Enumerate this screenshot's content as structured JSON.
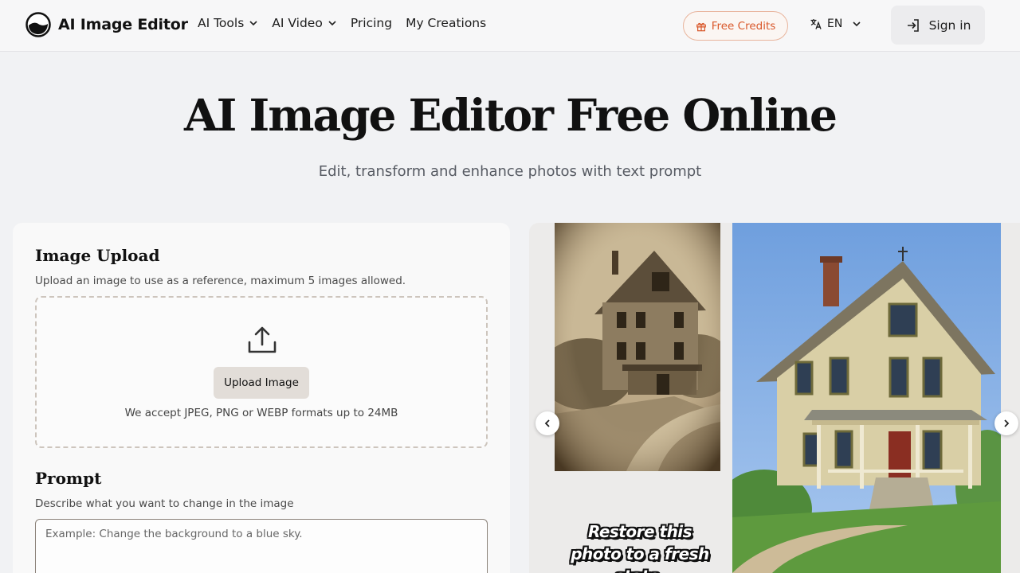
{
  "brand": {
    "name": "AI Image Editor"
  },
  "nav": [
    {
      "label": "AI Tools",
      "dropdown": true
    },
    {
      "label": "AI Video",
      "dropdown": true
    },
    {
      "label": "Pricing",
      "dropdown": false
    },
    {
      "label": "My Creations",
      "dropdown": false
    }
  ],
  "header": {
    "free_credits": "Free Credits",
    "language": "EN",
    "sign_in": "Sign in"
  },
  "hero": {
    "title": "AI Image Editor Free Online",
    "subtitle": "Edit, transform and enhance photos with text prompt"
  },
  "upload": {
    "heading": "Image Upload",
    "description": "Upload an image to use as a reference, maximum 5 images allowed.",
    "button": "Upload Image",
    "hint": "We accept JPEG, PNG or WEBP formats up to 24MB"
  },
  "prompt": {
    "heading": "Prompt",
    "description": "Describe what you want to change in the image",
    "placeholder": "Example: Change the background to a blue sky."
  },
  "showcase": {
    "caption": "Restore this photo to a fresh state."
  },
  "colors": {
    "accent": "#d9582b",
    "page_bg": "#f1f2f4",
    "card_bg": "#f9f9f9"
  },
  "icons": [
    "logo-icon",
    "chevron-down-icon",
    "gift-icon",
    "translate-icon",
    "login-icon",
    "upload-icon",
    "chevron-left-icon",
    "chevron-right-icon"
  ]
}
